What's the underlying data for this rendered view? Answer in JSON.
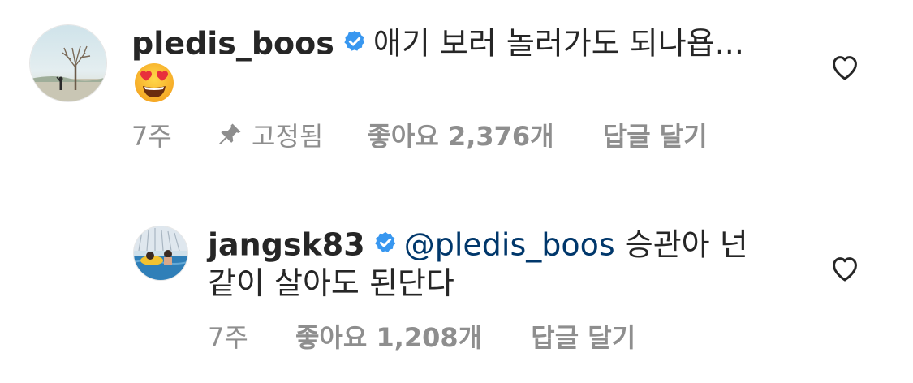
{
  "comments": [
    {
      "username": "pledis_boos",
      "text": "애기 보러 놀러가도 되나욥...",
      "emoji": "heart-eyes-emoji",
      "time": "7주",
      "pinned_label": "고정됨",
      "likes": "좋아요 2,376개",
      "reply": "답글 달기"
    },
    {
      "username": "jangsk83",
      "mention": "@pledis_boos",
      "text_line1": "승관아 넌",
      "text_line2": "같이 살아도 된단다",
      "time": "7주",
      "likes": "좋아요 1,208개",
      "reply": "답글 달기"
    }
  ],
  "icons": {
    "verified": "verified-badge-icon",
    "heart": "heart-outline-icon",
    "pin": "pin-icon"
  },
  "colors": {
    "verified": "#3897f0",
    "mention": "#00376b",
    "meta": "#8e8e8e",
    "text": "#262626"
  }
}
